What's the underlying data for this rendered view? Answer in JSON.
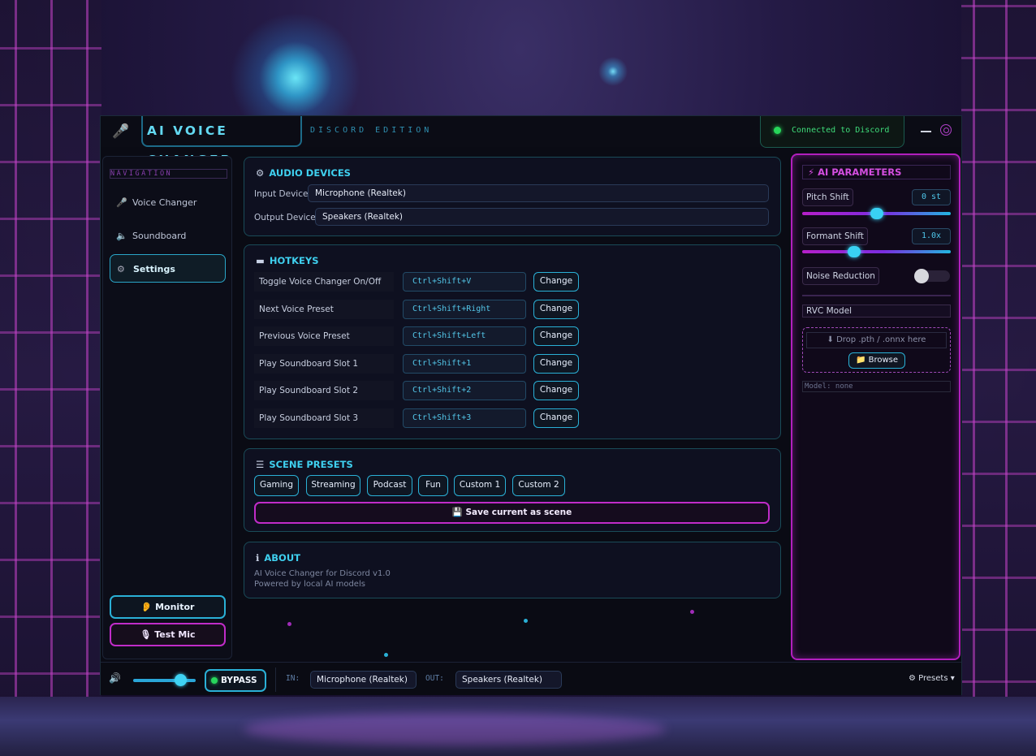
{
  "app": {
    "title": "AI VOICE CHANGER",
    "subtitle": "DISCORD EDITION",
    "connection_status": "Connected to Discord"
  },
  "sidebar": {
    "title": "NAVIGATION",
    "items": [
      {
        "label": "Voice Changer",
        "icon": "microphone-icon",
        "active": false
      },
      {
        "label": "Soundboard",
        "icon": "speaker-icon",
        "active": false
      },
      {
        "label": "Settings",
        "icon": "gear-icon",
        "active": true
      }
    ],
    "monitor_label": "👂 Monitor",
    "test_mic_label": "🎙 Test Mic"
  },
  "audio_devices": {
    "title": "AUDIO DEVICES",
    "input_label": "Input Device:",
    "input_value": "Microphone (Realtek)",
    "output_label": "Output Device:",
    "output_value": "Speakers (Realtek)"
  },
  "hotkeys": {
    "title": "HOTKEYS",
    "change_label": "Change",
    "rows": [
      {
        "action": "Toggle Voice Changer On/Off",
        "key": "Ctrl+Shift+V"
      },
      {
        "action": "Next Voice Preset",
        "key": "Ctrl+Shift+Right"
      },
      {
        "action": "Previous Voice Preset",
        "key": "Ctrl+Shift+Left"
      },
      {
        "action": "Play Soundboard Slot 1",
        "key": "Ctrl+Shift+1"
      },
      {
        "action": "Play Soundboard Slot 2",
        "key": "Ctrl+Shift+2"
      },
      {
        "action": "Play Soundboard Slot 3",
        "key": "Ctrl+Shift+3"
      }
    ]
  },
  "scene_presets": {
    "title": "SCENE PRESETS",
    "buttons": [
      "Gaming",
      "Streaming",
      "Podcast",
      "Fun",
      "Custom 1",
      "Custom 2"
    ],
    "save_label": "💾 Save current as scene"
  },
  "about": {
    "title": "ABOUT",
    "line1": "AI Voice Changer for Discord  v1.0",
    "line2": "Powered by local AI models"
  },
  "ai_parameters": {
    "title": "⚡ AI PARAMETERS",
    "pitch_label": "Pitch Shift",
    "pitch_value": "0 st",
    "pitch_fraction": 0.5,
    "formant_label": "Formant Shift",
    "formant_value": "1.0x",
    "formant_fraction": 0.35,
    "noise_label": "Noise Reduction",
    "noise_enabled": false,
    "rvc_label": "RVC Model",
    "drop_text": "⬇ Drop .pth / .onnx here",
    "browse_label": "📁 Browse",
    "model_status": "Model: none"
  },
  "bottom_bar": {
    "volume_fraction": 0.75,
    "bypass_label": "BYPASS",
    "in_label": "IN:",
    "in_value": "Microphone (Realtek)",
    "out_label": "OUT:",
    "out_value": "Speakers (Realtek)",
    "presets_label": "⚙ Presets ▾"
  },
  "colors": {
    "accent_cyan": "#2ab0d6",
    "accent_magenta": "#c02cc8",
    "status_green": "#27d65a"
  }
}
